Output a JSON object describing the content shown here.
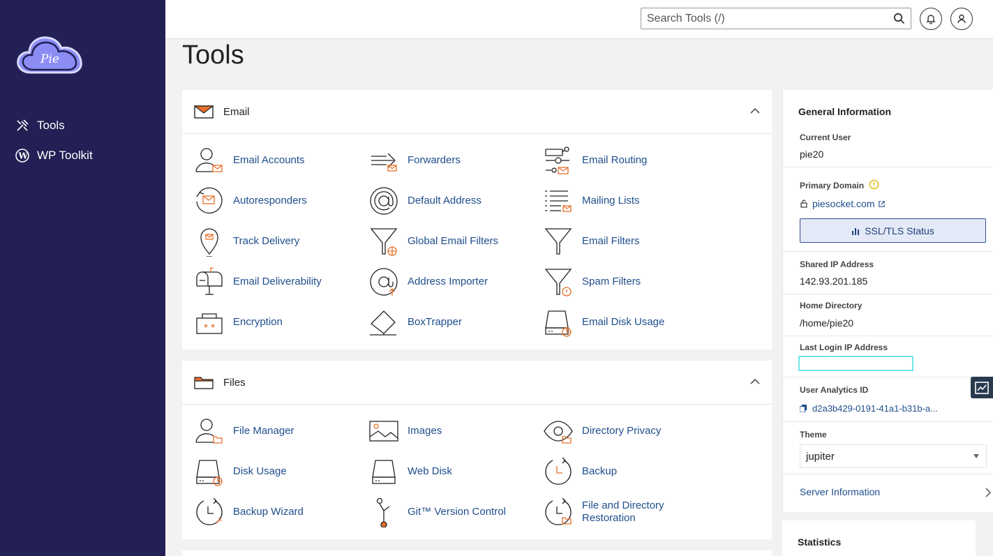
{
  "sidebar": {
    "logo_text": "Pie",
    "items": [
      {
        "label": "Tools",
        "icon": "tools-icon"
      },
      {
        "label": "WP Toolkit",
        "icon": "wordpress-icon"
      }
    ]
  },
  "topbar": {
    "search_placeholder": "Search Tools (/)",
    "notifications_icon": "bell-icon",
    "user_icon": "user-icon"
  },
  "page": {
    "title": "Tools"
  },
  "email_section": {
    "title": "Email",
    "tools": [
      {
        "label": "Email Accounts",
        "icon": "email-accounts-icon"
      },
      {
        "label": "Forwarders",
        "icon": "forwarders-icon"
      },
      {
        "label": "Email Routing",
        "icon": "email-routing-icon"
      },
      {
        "label": "Autoresponders",
        "icon": "autoresponders-icon"
      },
      {
        "label": "Default Address",
        "icon": "default-address-icon"
      },
      {
        "label": "Mailing Lists",
        "icon": "mailing-lists-icon"
      },
      {
        "label": "Track Delivery",
        "icon": "track-delivery-icon"
      },
      {
        "label": "Global Email Filters",
        "icon": "global-email-filters-icon"
      },
      {
        "label": "Email Filters",
        "icon": "email-filters-icon"
      },
      {
        "label": "Email Deliverability",
        "icon": "email-deliverability-icon"
      },
      {
        "label": "Address Importer",
        "icon": "address-importer-icon"
      },
      {
        "label": "Spam Filters",
        "icon": "spam-filters-icon"
      },
      {
        "label": "Encryption",
        "icon": "encryption-icon"
      },
      {
        "label": "BoxTrapper",
        "icon": "boxtrapper-icon"
      },
      {
        "label": "Email Disk Usage",
        "icon": "email-disk-usage-icon"
      }
    ]
  },
  "files_section": {
    "title": "Files",
    "tools": [
      {
        "label": "File Manager",
        "icon": "file-manager-icon"
      },
      {
        "label": "Images",
        "icon": "images-icon"
      },
      {
        "label": "Directory Privacy",
        "icon": "directory-privacy-icon"
      },
      {
        "label": "Disk Usage",
        "icon": "disk-usage-icon"
      },
      {
        "label": "Web Disk",
        "icon": "web-disk-icon"
      },
      {
        "label": "Backup",
        "icon": "backup-icon"
      },
      {
        "label": "Backup Wizard",
        "icon": "backup-wizard-icon"
      },
      {
        "label": "Git™ Version Control",
        "icon": "git-icon"
      },
      {
        "label": "File and Directory Restoration",
        "icon": "file-restoration-icon"
      }
    ]
  },
  "general_info": {
    "title": "General Information",
    "current_user_label": "Current User",
    "current_user": "pie20",
    "primary_domain_label": "Primary Domain",
    "primary_domain": "piesocket.com",
    "ssl_button": "SSL/TLS Status",
    "shared_ip_label": "Shared IP Address",
    "shared_ip": "142.93.201.185",
    "home_dir_label": "Home Directory",
    "home_dir": "/home/pie20",
    "last_login_label": "Last Login IP Address",
    "analytics_label": "User Analytics ID",
    "analytics_id": "d2a3b429-0191-41a1-b31b-a...",
    "theme_label": "Theme",
    "theme_value": "jupiter",
    "server_info": "Server Information"
  },
  "statistics": {
    "title": "Statistics"
  },
  "colors": {
    "sidebar": "#222054",
    "link": "#1f4e8c",
    "accent": "#e8702a",
    "logo": "#8b8df5"
  }
}
